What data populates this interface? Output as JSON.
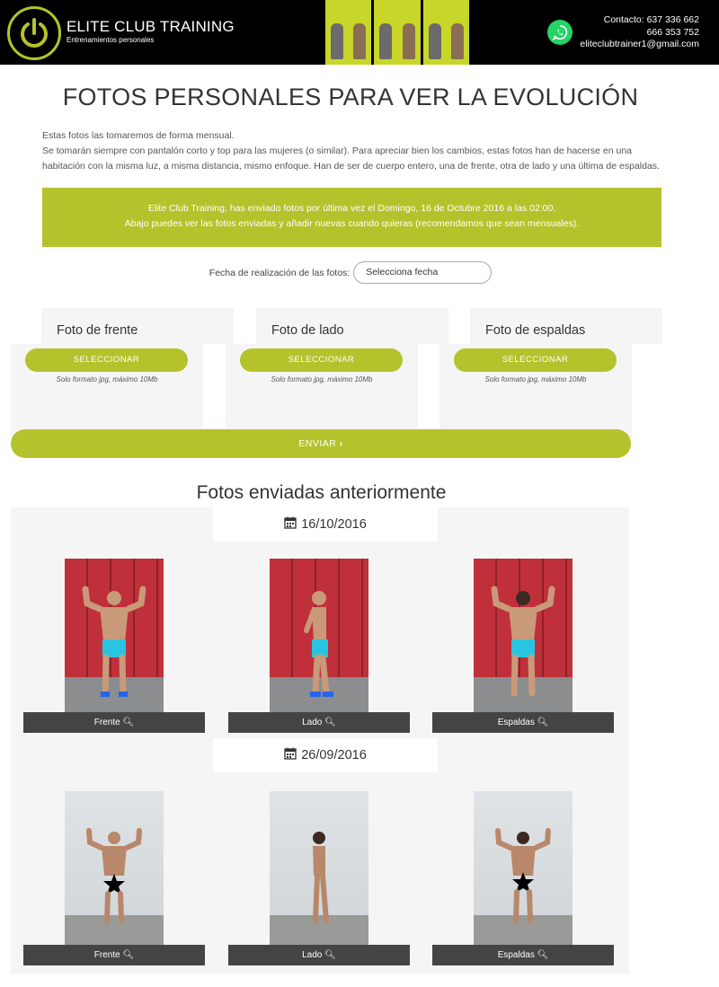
{
  "header": {
    "brand_title": "ELITE CLUB TRAINING",
    "brand_subtitle": "Entrenamientos personales",
    "contact_line1": "Contacto: 637 336 662",
    "contact_line2": "666 353 752",
    "contact_line3": "eliteclubtrainer1@gmail.com",
    "accent_color": "#b4c32c",
    "icons": [
      "power-logo-icon",
      "whatsapp-icon"
    ]
  },
  "page": {
    "title": "FOTOS PERSONALES PARA VER LA EVOLUCIÓN",
    "intro_line1": "Estas fotos las tomaremos de forma mensual.",
    "intro_line2": "Se tomarán siempre con pantalón corto y top para las mujeres (o similar). Para apreciar bien los cambios, estas fotos han de hacerse en una habitación con la misma luz, a misma distancia, mismo enfoque. Han de ser de cuerpo entero, una de frente, otra de lado y una última de espaldas."
  },
  "notice": {
    "line1": "Elite Club Training, has enviado fotos por última vez el Domingo, 16 de Octubre 2016 a las 02:00.",
    "line2": "Abajo puedes ver las fotos enviadas y añadir nuevas cuando quieras (recomendamos que sean mensuales)."
  },
  "date_field": {
    "label": "Fecha de realización de las fotos:",
    "placeholder": "Selecciona fecha"
  },
  "uploads": [
    {
      "label": "Foto de frente",
      "button": "SELECCIONAR",
      "hint": "Solo formato jpg, máximo 10Mb"
    },
    {
      "label": "Foto de lado",
      "button": "SELECCIONAR",
      "hint": "Solo formato jpg, máximo 10Mb"
    },
    {
      "label": "Foto de espaldas",
      "button": "SELECCIONAR",
      "hint": "Solo formato jpg, máximo 10Mb"
    }
  ],
  "send_button": "ENVIAR",
  "previous": {
    "title": "Fotos enviadas anteriormente",
    "groups": [
      {
        "date": "16/10/2016",
        "captions": [
          "Frente",
          "Lado",
          "Espaldas"
        ]
      },
      {
        "date": "26/09/2016",
        "captions": [
          "Frente",
          "Lado",
          "Espaldas"
        ]
      }
    ]
  }
}
